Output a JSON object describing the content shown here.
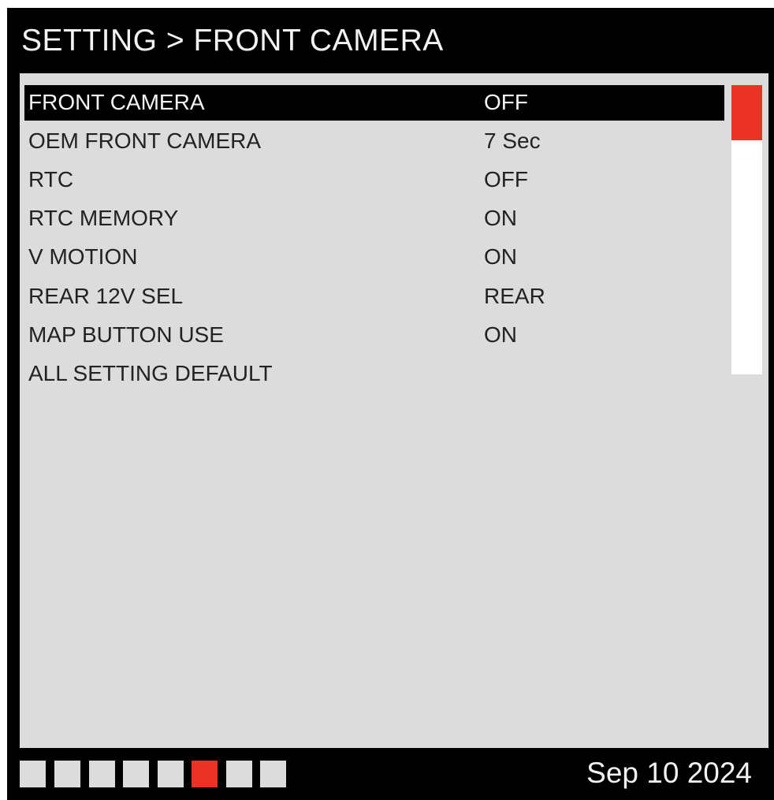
{
  "header": {
    "title": "SETTING > FRONT CAMERA"
  },
  "menu": {
    "selected_index": 0,
    "items": [
      {
        "label": "FRONT CAMERA",
        "value": "OFF"
      },
      {
        "label": "OEM FRONT CAMERA",
        "value": "7 Sec"
      },
      {
        "label": "RTC",
        "value": "OFF"
      },
      {
        "label": "RTC MEMORY",
        "value": "ON"
      },
      {
        "label": "V MOTION",
        "value": "ON"
      },
      {
        "label": "REAR 12V SEL",
        "value": "REAR"
      },
      {
        "label": "MAP BUTTON USE",
        "value": "ON"
      },
      {
        "label": "ALL SETTING DEFAULT",
        "value": ""
      }
    ]
  },
  "scrollbar": {
    "position_fraction": 0.0,
    "visible_fraction": 0.19
  },
  "pagination": {
    "total_pages": 8,
    "active_page": 6
  },
  "footer": {
    "date": "Sep 10 2024"
  },
  "colors": {
    "accent": "#ea3324",
    "background": "#000000",
    "panel": "#dcdcdc",
    "text_dark": "#222222",
    "text_light": "#f2f2f2"
  }
}
